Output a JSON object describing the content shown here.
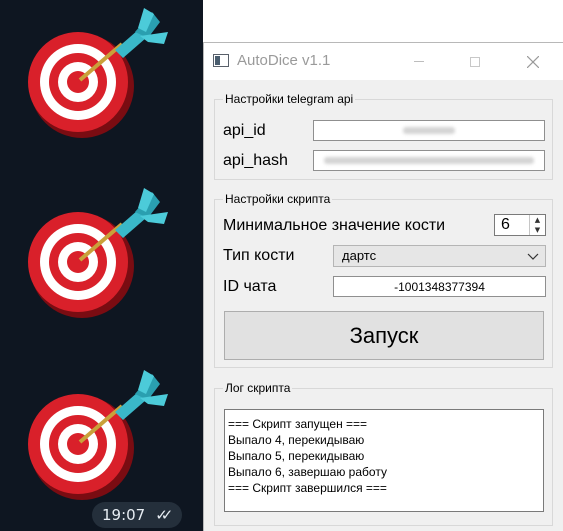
{
  "chat": {
    "time": "19:07",
    "read_status_icon": "double-check-icon"
  },
  "window": {
    "title": "AutoDice v1.1"
  },
  "telegram_group": {
    "title": "Настройки telegram api",
    "api_id_label": "api_id",
    "api_hash_label": "api_hash"
  },
  "script_group": {
    "title": "Настройки скрипта",
    "min_value_label": "Минимальное значение кости",
    "min_value": "6",
    "dice_type_label": "Тип кости",
    "dice_type_value": "дартс",
    "chat_id_label": "ID чата",
    "chat_id_value": "-1001348377394",
    "run_label": "Запуск"
  },
  "log_group": {
    "title": "Лог скрипта",
    "lines": [
      "=== Скрипт запущен ===",
      "Выпало 4, перекидываю",
      "Выпало 5, перекидываю",
      "Выпало 6, завершаю работу",
      "=== Скрипт завершился ==="
    ]
  },
  "colors": {
    "chat_bg": "#0e1621",
    "target_red": "#d9202a",
    "dart_teal": "#3ab8c9"
  }
}
